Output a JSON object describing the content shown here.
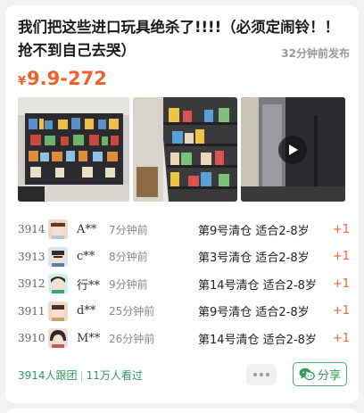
{
  "post": {
    "title": "我们把这些进口玩具绝杀了!!!!（必须定闹铃！！抢不到自己去哭）",
    "time": "32分钟前发布",
    "price_symbol": "¥",
    "price": "9.9-272"
  },
  "media": [
    {
      "type": "photo",
      "subject": "shelf of boxed toys"
    },
    {
      "type": "photo",
      "subject": "toy shelves in store"
    },
    {
      "type": "video",
      "subject": "elevator hallway",
      "icon": "play-icon"
    }
  ],
  "orders": [
    {
      "num": "3914",
      "user": "A**",
      "ago": "7分钟前",
      "item": "第9号清仓 适合2-8岁",
      "plus": "+1"
    },
    {
      "num": "3913",
      "user": "c**",
      "ago": "8分钟前",
      "item": "第3号清仓 适合2-8岁",
      "plus": "+1"
    },
    {
      "num": "3912",
      "user": "行**",
      "ago": "9分钟前",
      "item": "第14号清仓 适合2-8岁",
      "plus": "+1"
    },
    {
      "num": "3911",
      "user": "d**",
      "ago": "25分钟前",
      "item": "第9号清仓 适合2-8岁",
      "plus": "+1"
    },
    {
      "num": "3910",
      "user": "M**",
      "ago": "26分钟前",
      "item": "第14号清仓 适合2-8岁",
      "plus": "+1"
    }
  ],
  "footer": {
    "followers": "3914人跟团",
    "views": "11万人看过",
    "share_label": "分享",
    "more_icon": "more-dots-icon",
    "share_icon": "wechat-icon"
  },
  "colors": {
    "accent": "#f2602a",
    "green": "#2f9c5a"
  }
}
